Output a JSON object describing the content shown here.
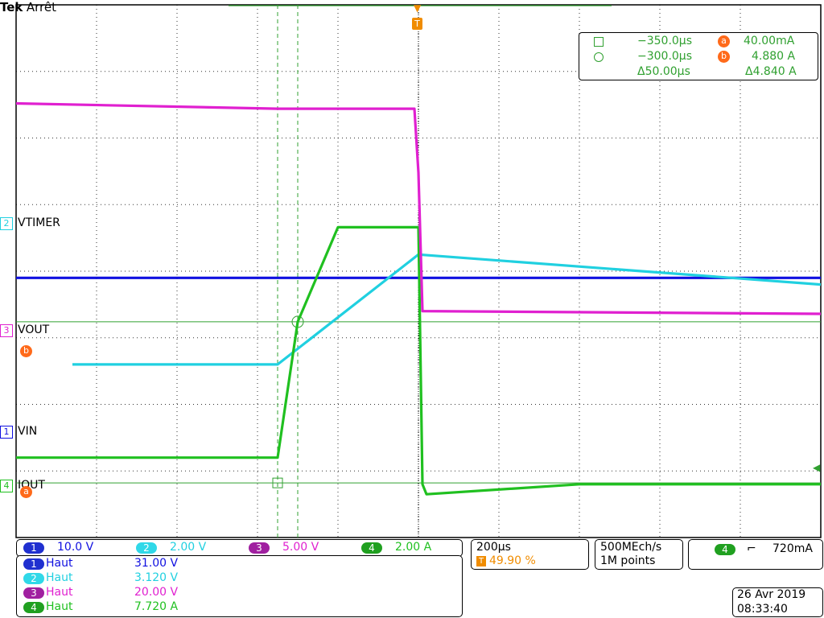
{
  "header": {
    "brand": "Tek",
    "state": "Arrêt"
  },
  "colors": {
    "ch1": "#1010e0",
    "ch2": "#20d0e0",
    "ch3": "#e020d0",
    "ch4": "#20c020",
    "orange": "#ff6a1a",
    "trig": "#f08c00",
    "cursor": "#30a030"
  },
  "markers": {
    "vtimer": "VTIMER",
    "vout": "VOUT",
    "vin": "VIN",
    "iout": "IOUT",
    "ch2": "2",
    "ch3": "3",
    "ch1": "1",
    "ch4": "4",
    "a": "a",
    "b": "b",
    "trig": "T"
  },
  "cursor_readout": {
    "t1": "−350.0µs",
    "t2": "−300.0µs",
    "dt": "Δ50.00µs",
    "a_val": "40.00mA",
    "b_val": "4.880 A",
    "dv": "Δ4.840 A",
    "a": "a",
    "b": "b"
  },
  "channels": [
    {
      "num": "1",
      "scale": "10.0 V"
    },
    {
      "num": "2",
      "scale": "2.00 V"
    },
    {
      "num": "3",
      "scale": "5.00 V"
    },
    {
      "num": "4",
      "scale": "2.00 A"
    }
  ],
  "measurements": [
    {
      "num": "1",
      "label": "Haut",
      "value": "31.00 V"
    },
    {
      "num": "2",
      "label": "Haut",
      "value": "3.120 V"
    },
    {
      "num": "3",
      "label": "Haut",
      "value": "20.00 V"
    },
    {
      "num": "4",
      "label": "Haut",
      "value": "7.720 A"
    }
  ],
  "timebase": {
    "scale": "200µs",
    "trig_pos": "49.90 %",
    "trig_icon": "T"
  },
  "acquisition": {
    "rate": "500MEch/s",
    "points": "1M points"
  },
  "trigger": {
    "source": "4",
    "slope": "⌐",
    "level": "720mA"
  },
  "datetime": {
    "date": "26 Avr  2019",
    "time": "08:33:40"
  },
  "chart_data": {
    "type": "line",
    "xlabel": "",
    "ylabel": "",
    "x_unit": "µs",
    "x_range": [
      -1000,
      1000
    ],
    "series": [
      {
        "name": "VTIMER",
        "x": [
          -860,
          -350,
          0,
          1000
        ],
        "y": [
          -0.4,
          -0.4,
          2.9,
          2.0
        ]
      },
      {
        "name": "VOUT",
        "x": [
          -1000,
          -350,
          -10,
          0,
          10,
          1000
        ],
        "y": [
          15.6,
          15.2,
          15.2,
          10.4,
          0,
          -0.2
        ]
      },
      {
        "name": "VIN",
        "x": [
          -1000,
          -350,
          0,
          1000
        ],
        "y": [
          31.0,
          31.0,
          31.0,
          31.0
        ]
      },
      {
        "name": "IOUT",
        "x": [
          -1000,
          -350,
          -300,
          -200,
          0,
          10,
          20,
          400,
          1000
        ],
        "y": [
          0.8,
          0.8,
          4.88,
          7.72,
          7.72,
          0,
          -0.3,
          0,
          0
        ]
      }
    ],
    "cursors": {
      "t1": -350,
      "t2": -300,
      "a": 0.04,
      "b": 4.88
    }
  }
}
